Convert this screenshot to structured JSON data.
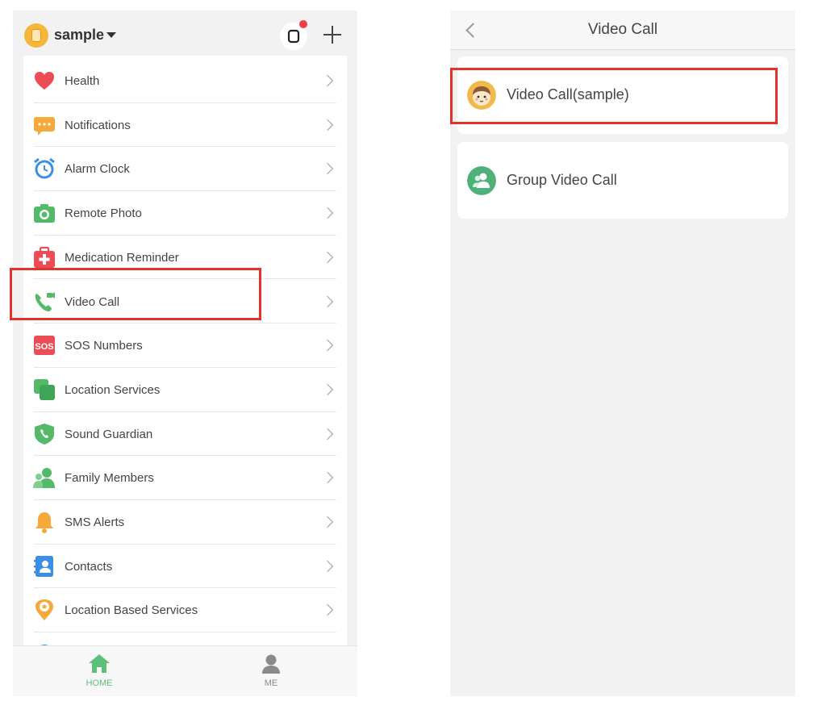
{
  "left_screen": {
    "device_name": "sample",
    "menu": [
      {
        "label": "Health",
        "icon": "heart-icon"
      },
      {
        "label": "Notifications",
        "icon": "message-icon"
      },
      {
        "label": "Alarm Clock",
        "icon": "alarm-clock-icon"
      },
      {
        "label": "Remote Photo",
        "icon": "camera-icon"
      },
      {
        "label": "Medication Reminder",
        "icon": "medical-kit-icon"
      },
      {
        "label": "Video Call",
        "icon": "video-phone-icon"
      },
      {
        "label": "SOS Numbers",
        "icon": "sos-icon",
        "icon_text": "SOS"
      },
      {
        "label": "Location Services",
        "icon": "location-squares-icon"
      },
      {
        "label": "Sound Guardian",
        "icon": "shield-phone-icon"
      },
      {
        "label": "Family Members",
        "icon": "family-icon"
      },
      {
        "label": "SMS Alerts",
        "icon": "bell-icon"
      },
      {
        "label": "Contacts",
        "icon": "contacts-book-icon"
      },
      {
        "label": "Location Based Services",
        "icon": "location-pin-icon"
      }
    ],
    "tabs": [
      {
        "label": "HOME",
        "icon": "home-icon",
        "active": true
      },
      {
        "label": "ME",
        "icon": "person-icon",
        "active": false
      }
    ],
    "highlighted_item": "Video Call"
  },
  "right_screen": {
    "title": "Video Call",
    "items": [
      {
        "label": "Video Call(sample)",
        "icon": "child-avatar-icon"
      },
      {
        "label": "Group Video Call",
        "icon": "group-icon"
      }
    ],
    "highlighted_item": "Video Call(sample)"
  },
  "colors": {
    "active_tab": "#5cbf7a",
    "inactive_tab": "#8a8a8a",
    "highlight_box": "#e0332a",
    "green_icon": "#55b96a"
  }
}
